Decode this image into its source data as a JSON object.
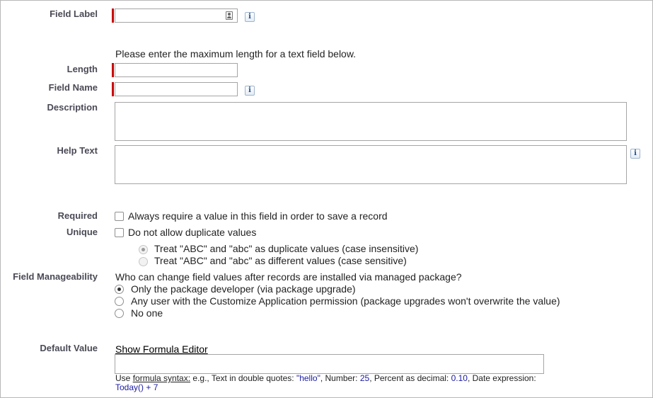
{
  "labels": {
    "field_label": "Field Label",
    "length": "Length",
    "field_name": "Field Name",
    "description": "Description",
    "help_text": "Help Text",
    "required": "Required",
    "unique": "Unique",
    "field_manageability": "Field Manageability",
    "default_value": "Default Value"
  },
  "inputs": {
    "field_label_value": "",
    "length_value": "",
    "field_name_value": "",
    "description_value": "",
    "help_text_value": "",
    "default_value_value": ""
  },
  "length_hint": "Please enter the maximum length for a text field below.",
  "info_icon_glyph": "i",
  "required_option": {
    "label": "Always require a value in this field in order to save a record",
    "checked": false
  },
  "unique_option": {
    "label": "Do not allow duplicate values",
    "checked": false
  },
  "case_options": [
    {
      "label": "Treat \"ABC\" and \"abc\" as duplicate values (case insensitive)",
      "checked": true,
      "disabled": true
    },
    {
      "label": "Treat \"ABC\" and \"abc\" as different values (case sensitive)",
      "checked": false,
      "disabled": true
    }
  ],
  "manageability": {
    "question": "Who can change field values after records are installed via managed package?",
    "options": [
      {
        "label": "Only the package developer (via package upgrade)",
        "checked": true
      },
      {
        "label": "Any user with the Customize Application permission (package upgrades won't overwrite the value)",
        "checked": false
      },
      {
        "label": "No one",
        "checked": false
      }
    ]
  },
  "default_value": {
    "formula_link": "Show Formula Editor",
    "hint": {
      "use": "Use ",
      "formula_syntax": "formula syntax:",
      "eg": " e.g., Text in double quotes: ",
      "hello": "\"hello\"",
      "number_label": ", Number: ",
      "number": "25",
      "percent_label": ", Percent as decimal: ",
      "percent": "0.10",
      "date_label": ", Date expression:",
      "date_expr": "Today() + 7"
    }
  },
  "colors": {
    "required_bar": "#cc0000",
    "label_text": "#4a4a56",
    "hint_blue": "#1a1aa6"
  }
}
